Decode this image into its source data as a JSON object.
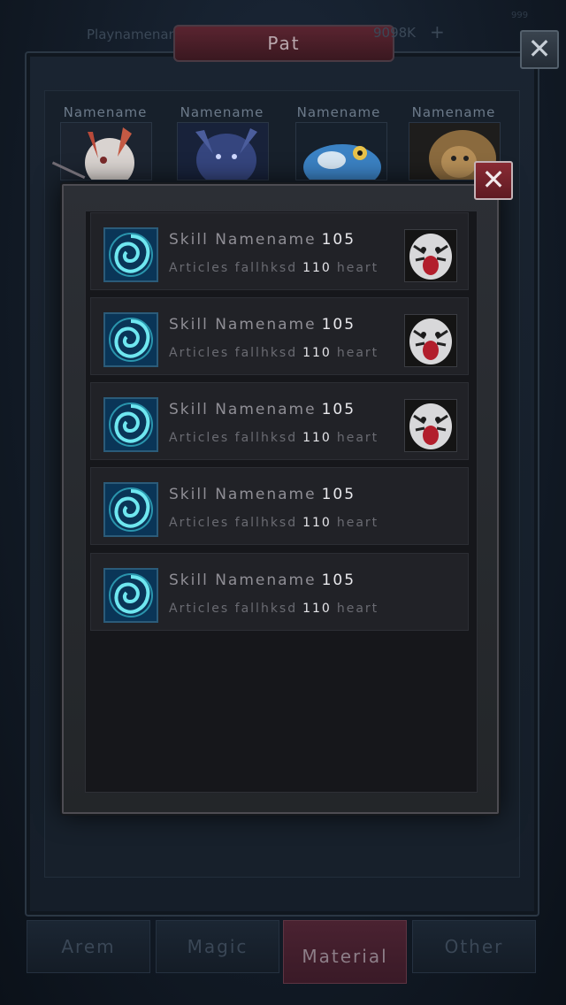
{
  "background": {
    "player_name": "Playnamename",
    "currency": "9098K",
    "plus": "+",
    "corner_text": "999",
    "header_title": "Pat",
    "close_symbol": "✕",
    "cards": [
      {
        "name": "Namename",
        "art": "white-creature-art"
      },
      {
        "name": "Namename",
        "art": "blue-demon-art"
      },
      {
        "name": "Namename",
        "art": "blue-toad-art"
      },
      {
        "name": "Namename",
        "art": "lion-art"
      }
    ],
    "tabs": [
      {
        "label": "Arem",
        "active": false
      },
      {
        "label": "Magic",
        "active": false
      },
      {
        "label": "Material",
        "active": true
      },
      {
        "label": "Other",
        "active": false
      }
    ]
  },
  "popup": {
    "close_symbol": "✕",
    "items": [
      {
        "title": "Skill Namename",
        "level": "105",
        "sub_prefix": "Articles fallhksd",
        "sub_value": "110",
        "sub_suffix": "heart",
        "has_portrait": true
      },
      {
        "title": "Skill Namename",
        "level": "105",
        "sub_prefix": "Articles fallhksd",
        "sub_value": "110",
        "sub_suffix": "heart",
        "has_portrait": true
      },
      {
        "title": "Skill Namename",
        "level": "105",
        "sub_prefix": "Articles fallhksd",
        "sub_value": "110",
        "sub_suffix": "heart",
        "has_portrait": true
      },
      {
        "title": "Skill Namename",
        "level": "105",
        "sub_prefix": "Articles fallhksd",
        "sub_value": "110",
        "sub_suffix": "heart",
        "has_portrait": false
      },
      {
        "title": "Skill Namename",
        "level": "105",
        "sub_prefix": "Articles fallhksd",
        "sub_value": "110",
        "sub_suffix": "heart",
        "has_portrait": false
      }
    ]
  },
  "colors": {
    "accent_red": "#8a2b34",
    "skill_icon_cyan": "#3fd6e6",
    "highlight_text": "#e8e8ec"
  }
}
